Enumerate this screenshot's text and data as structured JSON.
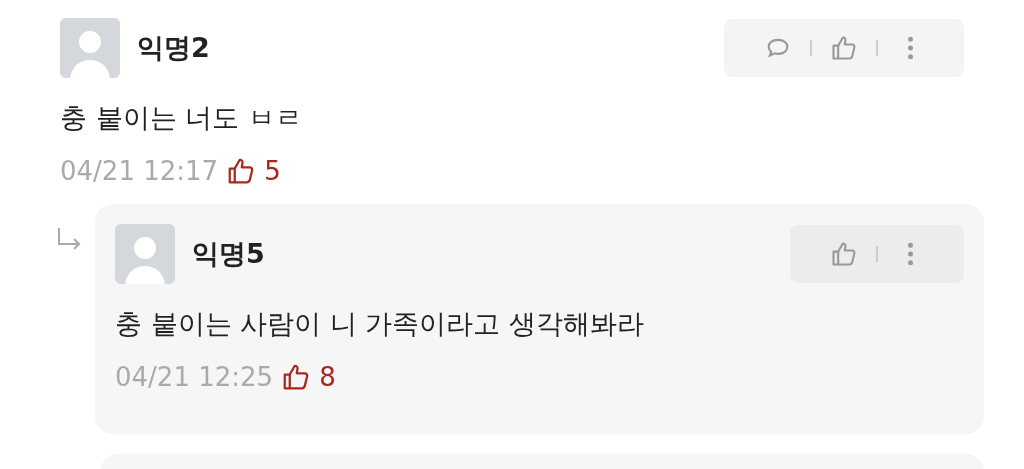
{
  "comments": [
    {
      "author": "익명2",
      "text": "충 붙이는 너도 ㅂㄹ",
      "time": "04/21 12:17",
      "likes": "5",
      "actions": [
        {
          "kind": "comment"
        },
        {
          "kind": "like"
        },
        {
          "kind": "more"
        }
      ],
      "replies": [
        {
          "author": "익명5",
          "text": "충 붙이는 사람이 니 가족이라고 생각해봐라",
          "time": "04/21 12:25",
          "likes": "8",
          "actions": [
            {
              "kind": "like"
            },
            {
              "kind": "more"
            }
          ]
        }
      ]
    }
  ]
}
